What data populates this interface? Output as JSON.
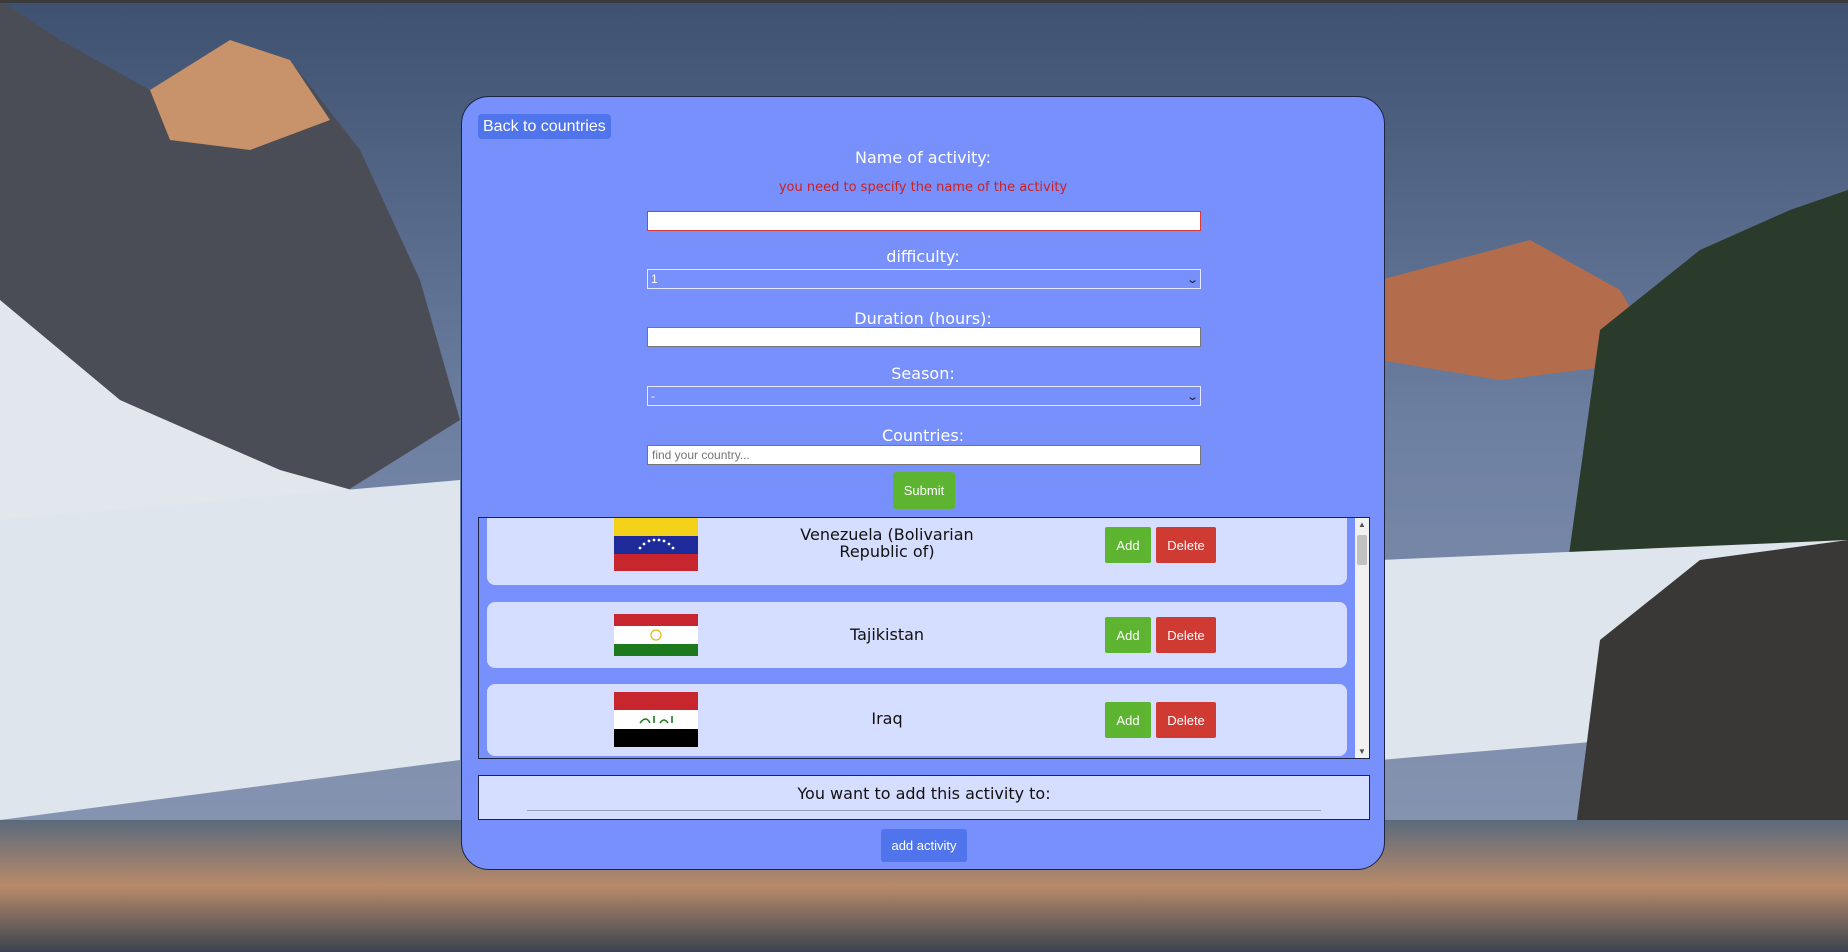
{
  "form": {
    "back_label": "Back to countries",
    "name_label": "Name of activity:",
    "name_error": "you need to specify the name of the activity",
    "name_value": "",
    "difficulty_label": "difficulty:",
    "difficulty_value": "1",
    "duration_label": "Duration (hours):",
    "duration_value": "",
    "season_label": "Season:",
    "season_value": "-",
    "countries_label": "Countries:",
    "countries_placeholder": "find your country...",
    "submit_label": "Submit"
  },
  "countries": [
    {
      "name": "Venezuela (Bolivarian Republic of)",
      "flag": "venezuela-flag",
      "add_label": "Add",
      "delete_label": "Delete"
    },
    {
      "name": "Tajikistan",
      "flag": "tajikistan-flag",
      "add_label": "Add",
      "delete_label": "Delete"
    },
    {
      "name": "Iraq",
      "flag": "iraq-flag",
      "add_label": "Add",
      "delete_label": "Delete"
    }
  ],
  "target": {
    "title": "You want to add this activity to:",
    "add_activity_label": "add activity"
  },
  "colors": {
    "card": "#7790fc",
    "error": "#cc2121",
    "add": "#5db431",
    "delete": "#cf3a33",
    "primary": "#4f74ec"
  }
}
